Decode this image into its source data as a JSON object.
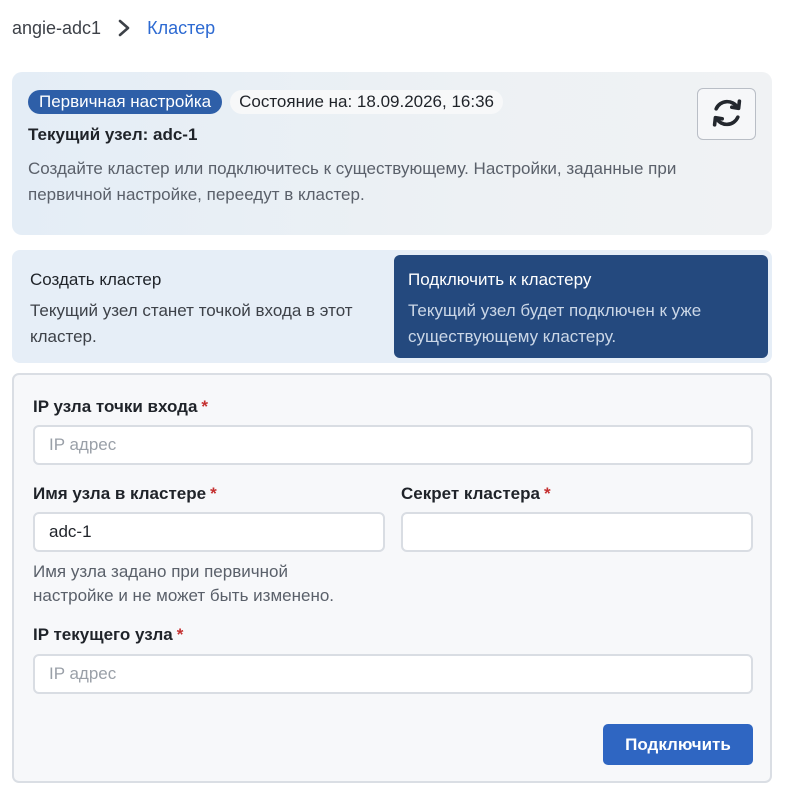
{
  "breadcrumb": {
    "root": "angie-adc1",
    "current": "Кластер",
    "separator_icon": "chevron-right-icon"
  },
  "status": {
    "badge_label": "Первичная настройка",
    "state_label": "Состояние на: 18.09.2026, 16:36",
    "node_title": "Текущий узел: adc-1",
    "description": "Создайте кластер или подключитесь к существующему. Настройки, заданные при первичной настройке, переедут в кластер.",
    "refresh_icon": "refresh-icon"
  },
  "modes": {
    "create": {
      "title": "Создать кластер",
      "description": "Текущий узел станет точкой входа в этот кластер."
    },
    "join": {
      "title": "Подключить к кластеру",
      "description": "Текущий узел будет подключен к уже существующему кластеру.",
      "selected": true
    }
  },
  "form": {
    "entry_ip": {
      "label": "IP узла точки входа",
      "required_mark": "*",
      "placeholder": "IP адрес",
      "value": ""
    },
    "node_name": {
      "label": "Имя узла в кластере",
      "required_mark": "*",
      "value": "adc-1",
      "hint": "Имя узла задано при первичной настройке и не может быть изменено."
    },
    "cluster_secret": {
      "label": "Секрет кластера",
      "required_mark": "*",
      "value": ""
    },
    "current_ip": {
      "label": "IP текущего узла",
      "required_mark": "*",
      "placeholder": "IP адрес",
      "value": ""
    },
    "submit_label": "Подключить"
  },
  "colors": {
    "accent": "#2f66c2",
    "badge": "#2e5fa8",
    "selected_mode": "#24497e",
    "required": "#c42f2f",
    "link": "#2d6ad2"
  }
}
